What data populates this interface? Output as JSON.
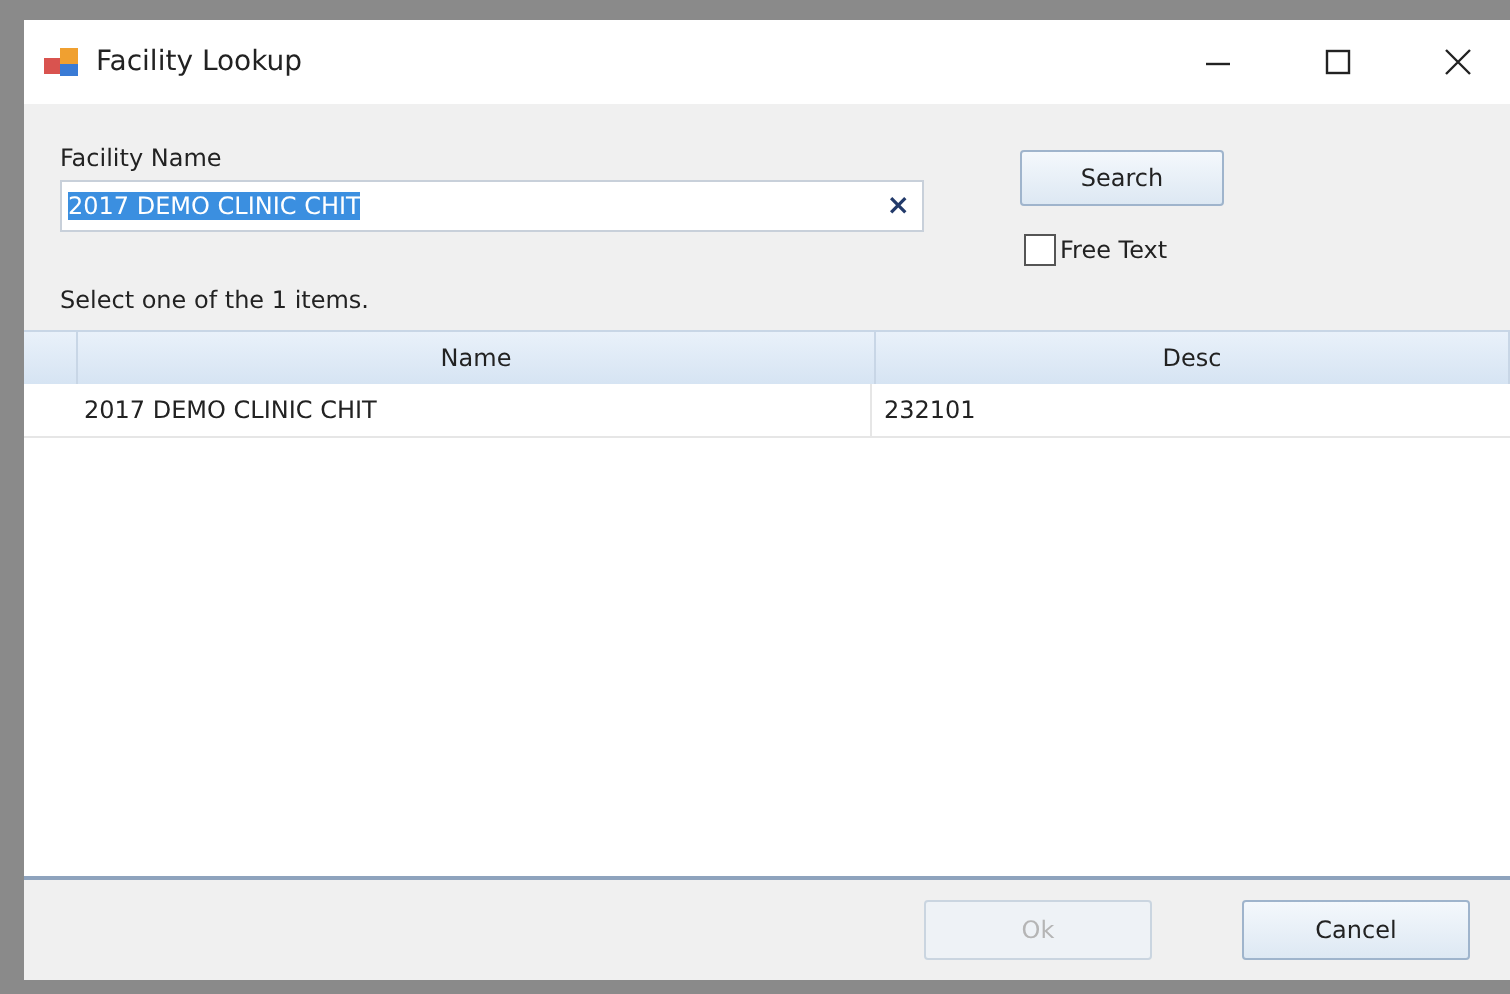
{
  "window": {
    "title": "Facility Lookup"
  },
  "field": {
    "label": "Facility Name",
    "value": "2017 DEMO CLINIC CHIT",
    "highlighted": true,
    "clear": "×"
  },
  "search_button": {
    "label": "Search"
  },
  "free_text": {
    "label": "Free Text",
    "checked": false
  },
  "prompt": "Select one of the 1 items.",
  "table": {
    "columns": [
      "Name",
      "Desc"
    ],
    "rows": [
      {
        "cells": [
          "2017 DEMO CLINIC CHIT",
          "232101"
        ],
        "selected": false
      }
    ]
  },
  "buttons": [
    {
      "label": "Ok",
      "disabled": true
    },
    {
      "label": "Cancel",
      "disabled": false
    }
  ]
}
